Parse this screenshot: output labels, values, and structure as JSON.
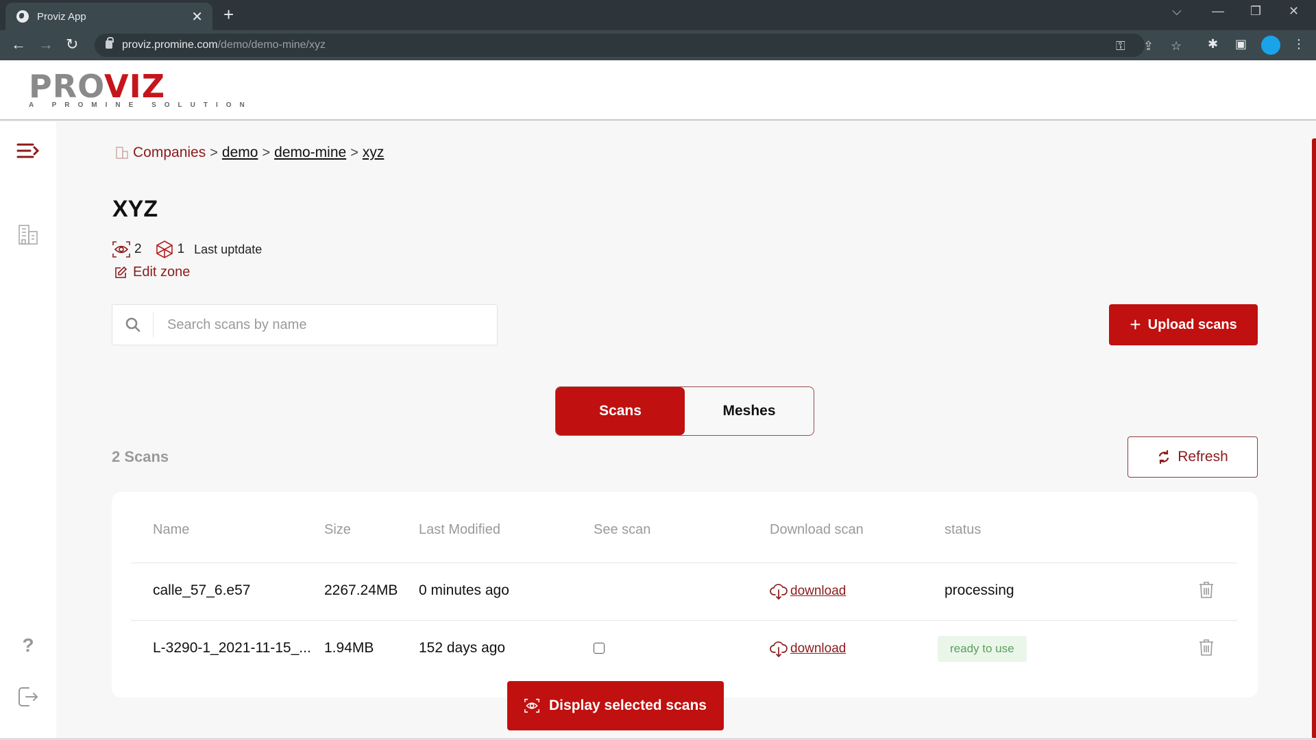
{
  "browser": {
    "tab_title": "Proviz App",
    "url_host": "proviz.promine.com",
    "url_path": "/demo/demo-mine/xyz",
    "icons": [
      "back-icon",
      "forward-icon",
      "reload-icon",
      "lock-icon",
      "key-icon",
      "share-icon",
      "star-icon",
      "extensions-icon",
      "sidepanel-icon",
      "profile-avatar",
      "menu-icon"
    ]
  },
  "header": {
    "logo_pro": "PRO",
    "logo_viz": "VIZ",
    "logo_tagline": "A PROMINE SOLUTION"
  },
  "sidebar": {
    "items": [
      {
        "icon": "menu-expand-icon"
      },
      {
        "icon": "companies-icon"
      },
      {
        "icon": "help-icon"
      },
      {
        "icon": "logout-icon"
      }
    ]
  },
  "breadcrumb": {
    "items": [
      "Companies",
      "demo",
      "demo-mine",
      "xyz"
    ],
    "separator": ">"
  },
  "zone": {
    "title": "XYZ",
    "scan_count": "2",
    "mesh_count": "1",
    "last_update_label": "Last uptdate",
    "edit_label": "Edit zone"
  },
  "search": {
    "placeholder": "Search scans by name",
    "value": ""
  },
  "actions": {
    "upload_label": "Upload scans",
    "refresh_label": "Refresh",
    "display_label": "Display selected scans"
  },
  "tabs": [
    {
      "label": "Scans",
      "active": true
    },
    {
      "label": "Meshes",
      "active": false
    }
  ],
  "scans": {
    "count_label": "2 Scans",
    "columns": [
      "Name",
      "Size",
      "Last Modified",
      "See scan",
      "Download scan",
      "status"
    ],
    "rows": [
      {
        "name": "calle_57_6.e57",
        "size": "2267.24MB",
        "modified": "0 minutes ago",
        "see_scan": null,
        "download": "download",
        "status": "processing"
      },
      {
        "name": "L-3290-1_2021-11-15_...",
        "size": "1.94MB",
        "modified": "152 days ago",
        "see_scan": false,
        "download": "download",
        "status": "ready to use"
      }
    ]
  },
  "colors": {
    "brand": "#c0100f",
    "brand_dark": "#8b1a1a",
    "ready_bg": "#eaf6ea",
    "ready_text": "#5aa05a"
  }
}
